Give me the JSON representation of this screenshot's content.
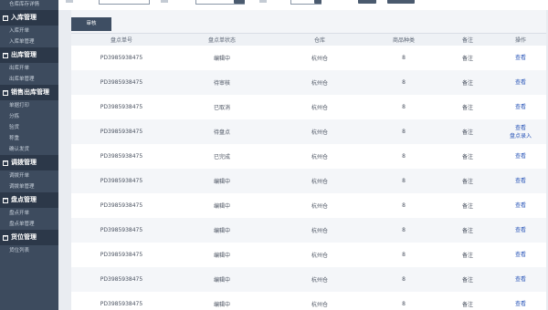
{
  "sidebar": {
    "top_item": "仓库库存详情",
    "sections": [
      {
        "title": "入库管理",
        "items": [
          "入库开单",
          "入库单管理"
        ]
      },
      {
        "title": "出库管理",
        "items": [
          "出库开单",
          "出库单管理"
        ]
      },
      {
        "title": "销售出库管理",
        "items": [
          "单据打印",
          "分拣",
          "验货",
          "称重",
          "确认发货"
        ]
      },
      {
        "title": "调拨管理",
        "items": [
          "调拨开单",
          "调拨单管理"
        ]
      },
      {
        "title": "盘点管理",
        "items": [
          "盘点开单",
          "盘点单管理"
        ]
      },
      {
        "title": "货位管理",
        "items": [
          "货位列表"
        ]
      }
    ]
  },
  "tab": {
    "label": "审核"
  },
  "table": {
    "headers": {
      "code": "盘点单号",
      "status": "盘点单状态",
      "warehouse": "仓库",
      "types": "商品种类",
      "remark": "备注",
      "op": "操作"
    },
    "rows": [
      {
        "code": "PD3985938475",
        "status": "编辑中",
        "warehouse": "杭州仓",
        "types": "8",
        "remark": "备注",
        "op1": "查看",
        "op2": ""
      },
      {
        "code": "PD3985938475",
        "status": "待审核",
        "warehouse": "杭州仓",
        "types": "8",
        "remark": "备注",
        "op1": "查看",
        "op2": ""
      },
      {
        "code": "PD3985938475",
        "status": "已取消",
        "warehouse": "杭州仓",
        "types": "8",
        "remark": "备注",
        "op1": "查看",
        "op2": ""
      },
      {
        "code": "PD3985938475",
        "status": "待盘点",
        "warehouse": "杭州仓",
        "types": "8",
        "remark": "备注",
        "op1": "查看",
        "op2": "盘点录入"
      },
      {
        "code": "PD3985938475",
        "status": "已完成",
        "warehouse": "杭州仓",
        "types": "8",
        "remark": "备注",
        "op1": "查看",
        "op2": ""
      },
      {
        "code": "PD3985938475",
        "status": "编辑中",
        "warehouse": "杭州仓",
        "types": "8",
        "remark": "备注",
        "op1": "查看",
        "op2": ""
      },
      {
        "code": "PD3985938475",
        "status": "编辑中",
        "warehouse": "杭州仓",
        "types": "8",
        "remark": "备注",
        "op1": "查看",
        "op2": ""
      },
      {
        "code": "PD3985938475",
        "status": "编辑中",
        "warehouse": "杭州仓",
        "types": "8",
        "remark": "备注",
        "op1": "查看",
        "op2": ""
      },
      {
        "code": "PD3985938475",
        "status": "编辑中",
        "warehouse": "杭州仓",
        "types": "8",
        "remark": "备注",
        "op1": "查看",
        "op2": ""
      },
      {
        "code": "PD3985938475",
        "status": "编辑中",
        "warehouse": "杭州仓",
        "types": "8",
        "remark": "备注",
        "op1": "查看",
        "op2": ""
      },
      {
        "code": "PD3985938475",
        "status": "编辑中",
        "warehouse": "杭州仓",
        "types": "8",
        "remark": "备注",
        "op1": "查看",
        "op2": ""
      }
    ]
  }
}
